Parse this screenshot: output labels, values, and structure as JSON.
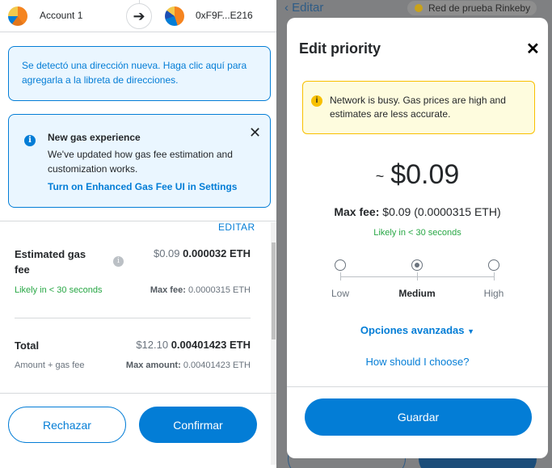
{
  "header": {
    "from_account": "Account 1",
    "to_account": "0xF9F...E216"
  },
  "new_address_notice": "Se detectó una dirección nueva. Haga clic aquí para agregarla a la libreta de direcciones.",
  "gas_notice": {
    "title": "New gas experience",
    "body": "We've updated how gas fee estimation and customization works.",
    "link": "Turn on Enhanced Gas Fee UI in Settings"
  },
  "details": {
    "edit_label": "EDITAR",
    "gas_label_line1": "Estimated gas",
    "gas_label_line2": "fee",
    "gas_fiat": "$0.09",
    "gas_eth": "0.000032 ETH",
    "gas_likely": "Likely in < 30 seconds",
    "max_fee_label": "Max fee:",
    "max_fee_value": "0.0000315 ETH",
    "total_label": "Total",
    "total_fiat": "$12.10",
    "total_eth": "0.00401423 ETH",
    "total_sub": "Amount + gas fee",
    "max_amount_label": "Max amount:",
    "max_amount_value": "0.00401423 ETH"
  },
  "actions": {
    "reject": "Rechazar",
    "confirm": "Confirmar"
  },
  "background": {
    "back_label": "Editar",
    "network": "Red de prueba Rinkeby"
  },
  "modal": {
    "title": "Edit priority",
    "warning": "Network is busy. Gas prices are high and estimates are less accurate.",
    "tilde": "~",
    "fee": "$0.09",
    "max_fee_label": "Max fee:",
    "max_fee_fiat": "$0.09",
    "max_fee_eth": "(0.0000315 ETH)",
    "likely": "Likely in < 30 seconds",
    "options": [
      "Low",
      "Medium",
      "High"
    ],
    "selected_option": "Medium",
    "advanced": "Opciones avanzadas",
    "how_choose": "How should I choose?",
    "save": "Guardar"
  },
  "colors": {
    "primary": "#037dd6",
    "success": "#28a745",
    "warning_border": "#f8c000",
    "warning_bg": "#fefcde",
    "info_bg": "#eaf6ff",
    "backdrop": "#7f8082"
  },
  "icons": [
    "arrow-right-icon",
    "info-icon",
    "close-icon",
    "warning-icon",
    "chevron-down-icon",
    "radio-icon",
    "chevron-left-icon"
  ]
}
